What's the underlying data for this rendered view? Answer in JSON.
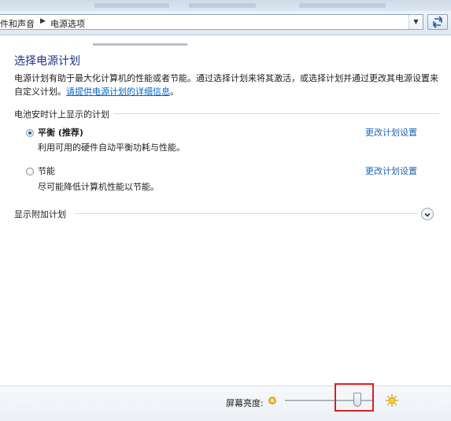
{
  "address_bar": {
    "breadcrumb_1": "件和声音",
    "breadcrumb_2": "电源选项"
  },
  "main": {
    "title": "选择电源计划",
    "description": "电源计划有助于最大化计算机的性能或者节能。通过选择计划来将其激活，或选择计划并通过更改其电源设置来自定义计划。",
    "description_link": "请提供电源计划的详细信息",
    "section_label": "电池安时计上显示的计划",
    "plans": [
      {
        "name": "平衡 (推荐)",
        "description": "利用可用的硬件自动平衡功耗与性能。",
        "selected": true,
        "link": "更改计划设置"
      },
      {
        "name": "节能",
        "description": "尽可能降低计算机性能以节能。",
        "selected": false,
        "link": "更改计划设置"
      }
    ],
    "additional_plans_label": "显示附加计划"
  },
  "brightness": {
    "label": "屏幕亮度:",
    "level_percent": 82,
    "low_icon": "dim-sun-icon",
    "high_icon": "bright-sun-icon"
  },
  "colors": {
    "title": "#1e3287",
    "link": "#1e64b4",
    "highlight": "#d82020"
  }
}
